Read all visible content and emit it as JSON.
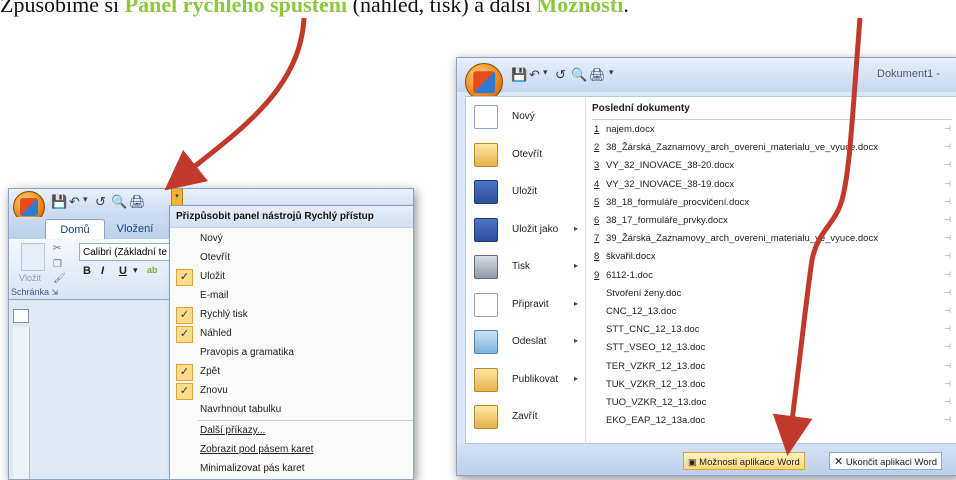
{
  "caption": {
    "pre": "Způsobíme si ",
    "hl1": "Panel rychlého spuštění",
    "mid": " (náhled, tisk) a další ",
    "hl2": "Možnosti",
    "end": "."
  },
  "left_window": {
    "quick_access_icons": [
      "save-icon",
      "undo-icon",
      "redo-icon",
      "print-preview-icon",
      "quick-print-icon"
    ],
    "tabs": [
      "Domů",
      "Vložení"
    ],
    "font_name": "Calibri (Základní te",
    "paste_label": "Vložit",
    "format_buttons": [
      "B",
      "I",
      "U"
    ],
    "group_label": "Schránka",
    "customize_menu": {
      "title": "Přizpůsobit panel nástrojů Rychlý přístup",
      "items": [
        {
          "label": "Nový",
          "checked": false
        },
        {
          "label": "Otevřít",
          "checked": false
        },
        {
          "label": "Uložit",
          "checked": true
        },
        {
          "label": "E-mail",
          "checked": false
        },
        {
          "label": "Rychlý tisk",
          "checked": true
        },
        {
          "label": "Náhled",
          "checked": true
        },
        {
          "label": "Pravopis a gramatika",
          "checked": false
        },
        {
          "label": "Zpět",
          "checked": true
        },
        {
          "label": "Znovu",
          "checked": true
        },
        {
          "label": "Navrhnout tabulku",
          "checked": false
        },
        {
          "label": "Další příkazy...",
          "checked": false
        },
        {
          "label": "Zobrazit pod pásem karet",
          "checked": false
        },
        {
          "label": "Minimalizovat pás karet",
          "checked": false
        }
      ]
    }
  },
  "right_window": {
    "title": "Dokument1 -",
    "menu": [
      {
        "label": "Nový",
        "icon": "new-document-icon",
        "arrow": false
      },
      {
        "label": "Otevřít",
        "icon": "open-folder-icon",
        "arrow": false
      },
      {
        "label": "Uložit",
        "icon": "save-icon",
        "arrow": false
      },
      {
        "label": "Uložit jako",
        "icon": "save-as-icon",
        "arrow": true
      },
      {
        "label": "Tisk",
        "icon": "printer-icon",
        "arrow": true
      },
      {
        "label": "Připravit",
        "icon": "prepare-icon",
        "arrow": true
      },
      {
        "label": "Odeslat",
        "icon": "send-icon",
        "arrow": true
      },
      {
        "label": "Publikovat",
        "icon": "publish-icon",
        "arrow": true
      },
      {
        "label": "Zavřít",
        "icon": "close-folder-icon",
        "arrow": false
      }
    ],
    "recent_header": "Poslední dokumenty",
    "recent": [
      {
        "num": "1",
        "name": "najem.docx"
      },
      {
        "num": "2",
        "name": "38_Žárská_Zaznamovy_arch_overeni_materialu_ve_vyuce.docx"
      },
      {
        "num": "3",
        "name": "VY_32_INOVACE_38-20.docx"
      },
      {
        "num": "4",
        "name": "VY_32_INOVACE_38-19.docx"
      },
      {
        "num": "5",
        "name": "38_18_formuláře_procvičení.docx"
      },
      {
        "num": "6",
        "name": "38_17_formuláře_prvky.docx"
      },
      {
        "num": "7",
        "name": "39_Žárská_Zaznamovy_arch_overeni_materialu_ve_vyuce.docx"
      },
      {
        "num": "8",
        "name": "škvařil.docx"
      },
      {
        "num": "9",
        "name": "6112-1.doc"
      },
      {
        "num": "",
        "name": "Stvoření ženy.doc"
      },
      {
        "num": "",
        "name": "CNC_12_13.doc"
      },
      {
        "num": "",
        "name": "STT_CNC_12_13.doc"
      },
      {
        "num": "",
        "name": "STT_VSEO_12_13.doc"
      },
      {
        "num": "",
        "name": "TER_VZKR_12_13.doc"
      },
      {
        "num": "",
        "name": "TUK_VZKR_12_13.doc"
      },
      {
        "num": "",
        "name": "TUO_VZKR_12_13.doc"
      },
      {
        "num": "",
        "name": "EKO_EAP_12_13a.doc"
      }
    ],
    "word_options_label": "Možnosti aplikace Word",
    "exit_label": "Ukončit aplikaci Word"
  },
  "colors": {
    "highlight": "#8dc63f",
    "arrow": "#c0392b"
  }
}
